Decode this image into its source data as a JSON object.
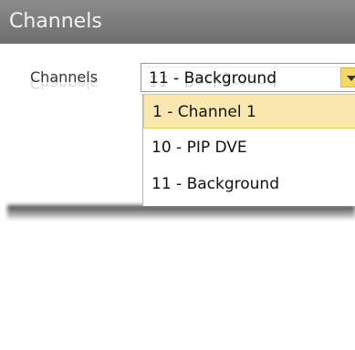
{
  "panel": {
    "title": "Channels"
  },
  "field": {
    "label": "Channels",
    "value": "11 - Background"
  },
  "dropdown": {
    "items": [
      {
        "label": "1 - Channel 1",
        "selected": true
      },
      {
        "label": "10 - PIP DVE",
        "selected": false
      },
      {
        "label": "11 - Background",
        "selected": false
      }
    ]
  },
  "colors": {
    "header_bg": "#6f6f6f",
    "selection_bg": "#f8e7ae",
    "combo_button": "#f3d769"
  },
  "icons": {
    "dropdown_arrow": "chevron-down-icon"
  }
}
